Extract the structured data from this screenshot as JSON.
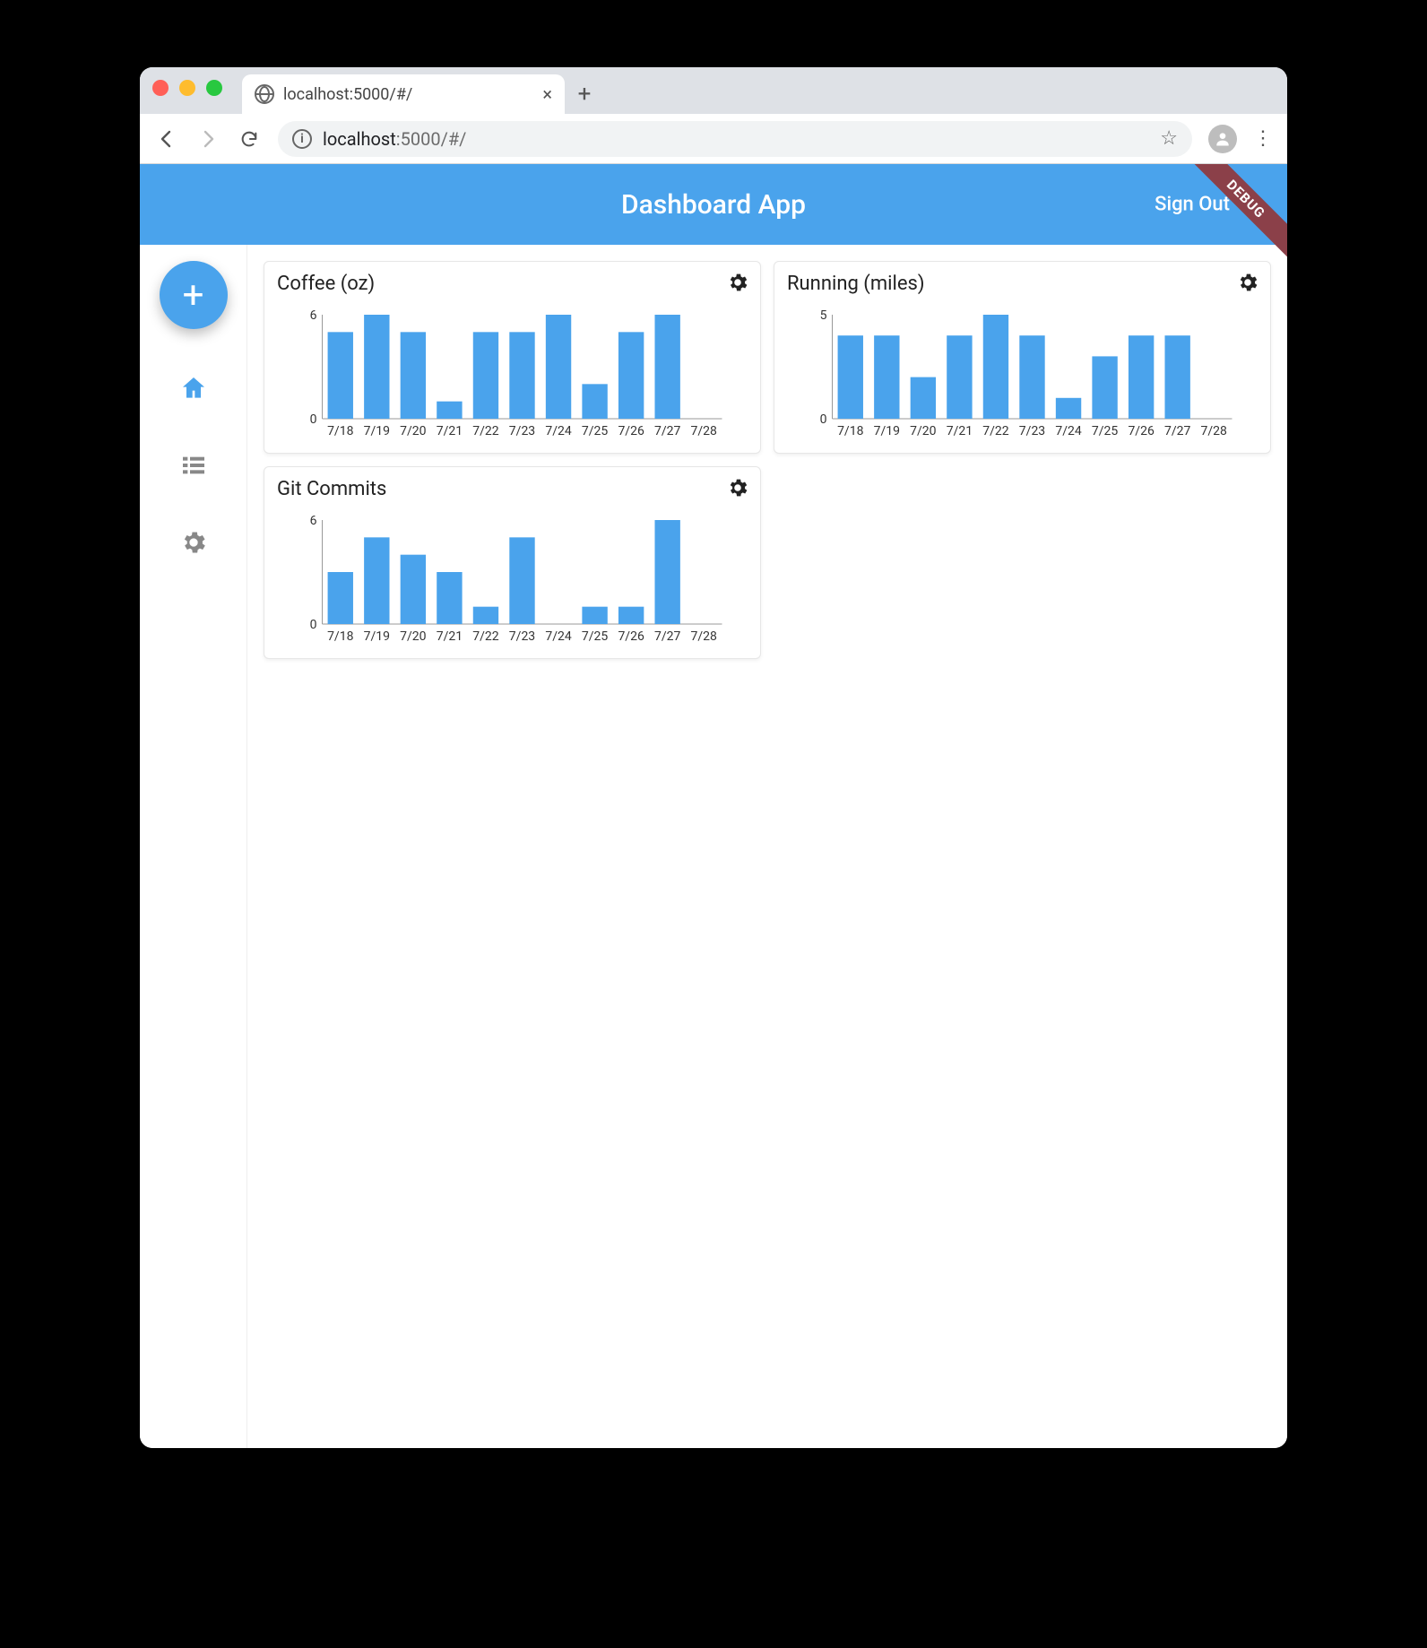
{
  "browser": {
    "tab_title": "localhost:5000/#/",
    "url_host": "localhost",
    "url_path": ":5000/#/"
  },
  "header": {
    "title": "Dashboard App",
    "sign_out": "Sign Out",
    "debug_label": "DEBUG"
  },
  "sidebar": {
    "fab_label": "+",
    "items": [
      "home",
      "list",
      "settings"
    ]
  },
  "cards": [
    {
      "id": "coffee",
      "title": "Coffee (oz)"
    },
    {
      "id": "running",
      "title": "Running (miles)"
    },
    {
      "id": "commits",
      "title": "Git Commits"
    }
  ],
  "chart_data": [
    {
      "id": "coffee",
      "type": "bar",
      "title": "Coffee (oz)",
      "categories": [
        "7/18",
        "7/19",
        "7/20",
        "7/21",
        "7/22",
        "7/23",
        "7/24",
        "7/25",
        "7/26",
        "7/27",
        "7/28"
      ],
      "values": [
        5,
        6,
        5,
        1,
        5,
        5,
        6,
        2,
        5,
        6,
        0
      ],
      "ylim": [
        0,
        6
      ],
      "yticks": [
        0,
        6
      ],
      "xlabel": "",
      "ylabel": ""
    },
    {
      "id": "running",
      "type": "bar",
      "title": "Running (miles)",
      "categories": [
        "7/18",
        "7/19",
        "7/20",
        "7/21",
        "7/22",
        "7/23",
        "7/24",
        "7/25",
        "7/26",
        "7/27",
        "7/28"
      ],
      "values": [
        4,
        4,
        2,
        4,
        5,
        4,
        1,
        3,
        4,
        4,
        0
      ],
      "ylim": [
        0,
        5
      ],
      "yticks": [
        0,
        5
      ],
      "xlabel": "",
      "ylabel": ""
    },
    {
      "id": "commits",
      "type": "bar",
      "title": "Git Commits",
      "categories": [
        "7/18",
        "7/19",
        "7/20",
        "7/21",
        "7/22",
        "7/23",
        "7/24",
        "7/25",
        "7/26",
        "7/27",
        "7/28"
      ],
      "values": [
        3,
        5,
        4,
        3,
        1,
        5,
        0,
        1,
        1,
        6,
        0
      ],
      "ylim": [
        0,
        6
      ],
      "yticks": [
        0,
        6
      ],
      "xlabel": "",
      "ylabel": ""
    }
  ]
}
